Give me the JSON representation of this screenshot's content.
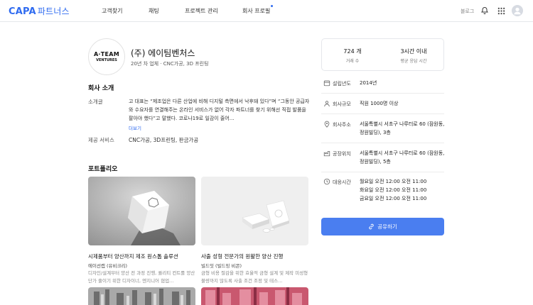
{
  "nav": {
    "logo_main": "CAPA",
    "logo_sub": "파트너스",
    "menu": [
      "고객찾기",
      "채팅",
      "프로젝트 관리",
      "회사 프로필"
    ],
    "blog": "블로그"
  },
  "company": {
    "logo_line1": "A·TEAM",
    "logo_line2": "VENTURES",
    "name": "(주) 에이팀벤처스",
    "meta": "20년 차 업체 · CNC가공, 3D 프린팅"
  },
  "intro": {
    "section_title": "회사 소개",
    "label": "소개글",
    "text": "고 대표는 “제조업은 다른 산업에 비해 디지털 측면에서 낙후돼 있다”며 “그동안 공급자와 수요자를 연결해주는 온라인 서비스가 없어 각자 파트너를 찾기 위해선 직접 발품을 팔아야 했다”고 말했다. 코로나19로 일감이 줄어…",
    "more": "더보기",
    "services_label": "제공 서비스",
    "services": "CNC가공, 3D프린팅, 판금가공"
  },
  "portfolio": {
    "section_title": "포트폴리오",
    "items": [
      {
        "title": "시제품부터 양산까지 제조 원스톱 솔루션",
        "subtitle": "에이선캡 (유비크리)",
        "desc": "디자인/설계부터 양산 전 과정 진행, 퀄리티 컨트롤 양산 단가 줄이기 위한 디자이너, 엔지니어 협업…"
      },
      {
        "title": "사출 성형 전문가의 원활한 양산 진행",
        "subtitle": "빌드잇 (빌드잉 비콘)",
        "desc": "금형 비용 절감을 위한 효율적 금형 설계 및 제작 미성형 불량까지 많도록 사출 조건 조정 및 테스…"
      }
    ]
  },
  "stats": [
    {
      "value": "724 개",
      "label": "거래 수"
    },
    {
      "value": "3시간 이내",
      "label": "평균 응답 시간"
    }
  ],
  "info": {
    "founded": {
      "label": "설립년도",
      "value": "2014년"
    },
    "size": {
      "label": "회사규모",
      "value": "직원 1000명 이상"
    },
    "address": {
      "label": "회사주소",
      "line1": "서울특별시 서초구 나루터로 60 (잠원동,",
      "line2": "정원빌딩), 3층"
    },
    "factory": {
      "label": "공장위치",
      "line1": "서울특별시 서초구 나루터로 60 (잠원동,",
      "line2": "정원빌딩), 5층"
    },
    "hours": {
      "label": "대응시간",
      "line1": "월요일 오전 12:00 오전 11:00",
      "line2": "화요일 오전 12:00 오전 11:00",
      "line3": "금요일 오전 12:00 오전 11:00"
    }
  },
  "share_label": "공유하기"
}
